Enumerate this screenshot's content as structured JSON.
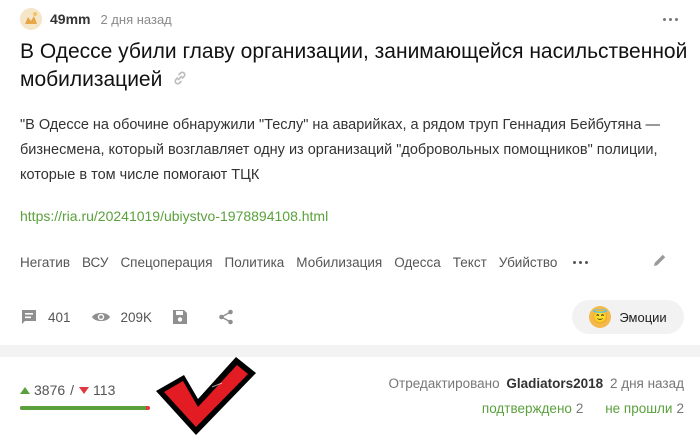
{
  "post": {
    "author": "49mm",
    "time": "2 дня назад",
    "title": "В Одессе убили главу организации, занимающейся насильственной мобилизацией",
    "body": "\"В Одессе на обочине обнаружили \"Теслу\" на аварийках, а рядом труп Геннадия Бейбутяна — бизнесмена, который возглавляет одну из организаций \"добровольных помощников\" полиции, которые в том числе помогают ТЦК",
    "url": "https://ria.ru/20241019/ubiystvo-1978894108.html",
    "tags": [
      "Негатив",
      "ВСУ",
      "Спецоперация",
      "Политика",
      "Мобилизация",
      "Одесса",
      "Текст",
      "Убийство"
    ]
  },
  "stats": {
    "comments": "401",
    "views": "209K",
    "emotions_label": "Эмоции"
  },
  "rating": {
    "up": "3876",
    "slash": "/",
    "down": "113",
    "up_fraction": 0.97
  },
  "edit_info": {
    "prefix": "Отредактировано",
    "editor": "Gladiators2018",
    "time": "2 дня назад"
  },
  "moderation": {
    "confirmed_label": "подтверждено",
    "confirmed_count": "2",
    "failed_label": "не прошли",
    "failed_count": "2"
  },
  "colors": {
    "accent_green": "#5aa13c",
    "rating_red": "#e0383e"
  }
}
